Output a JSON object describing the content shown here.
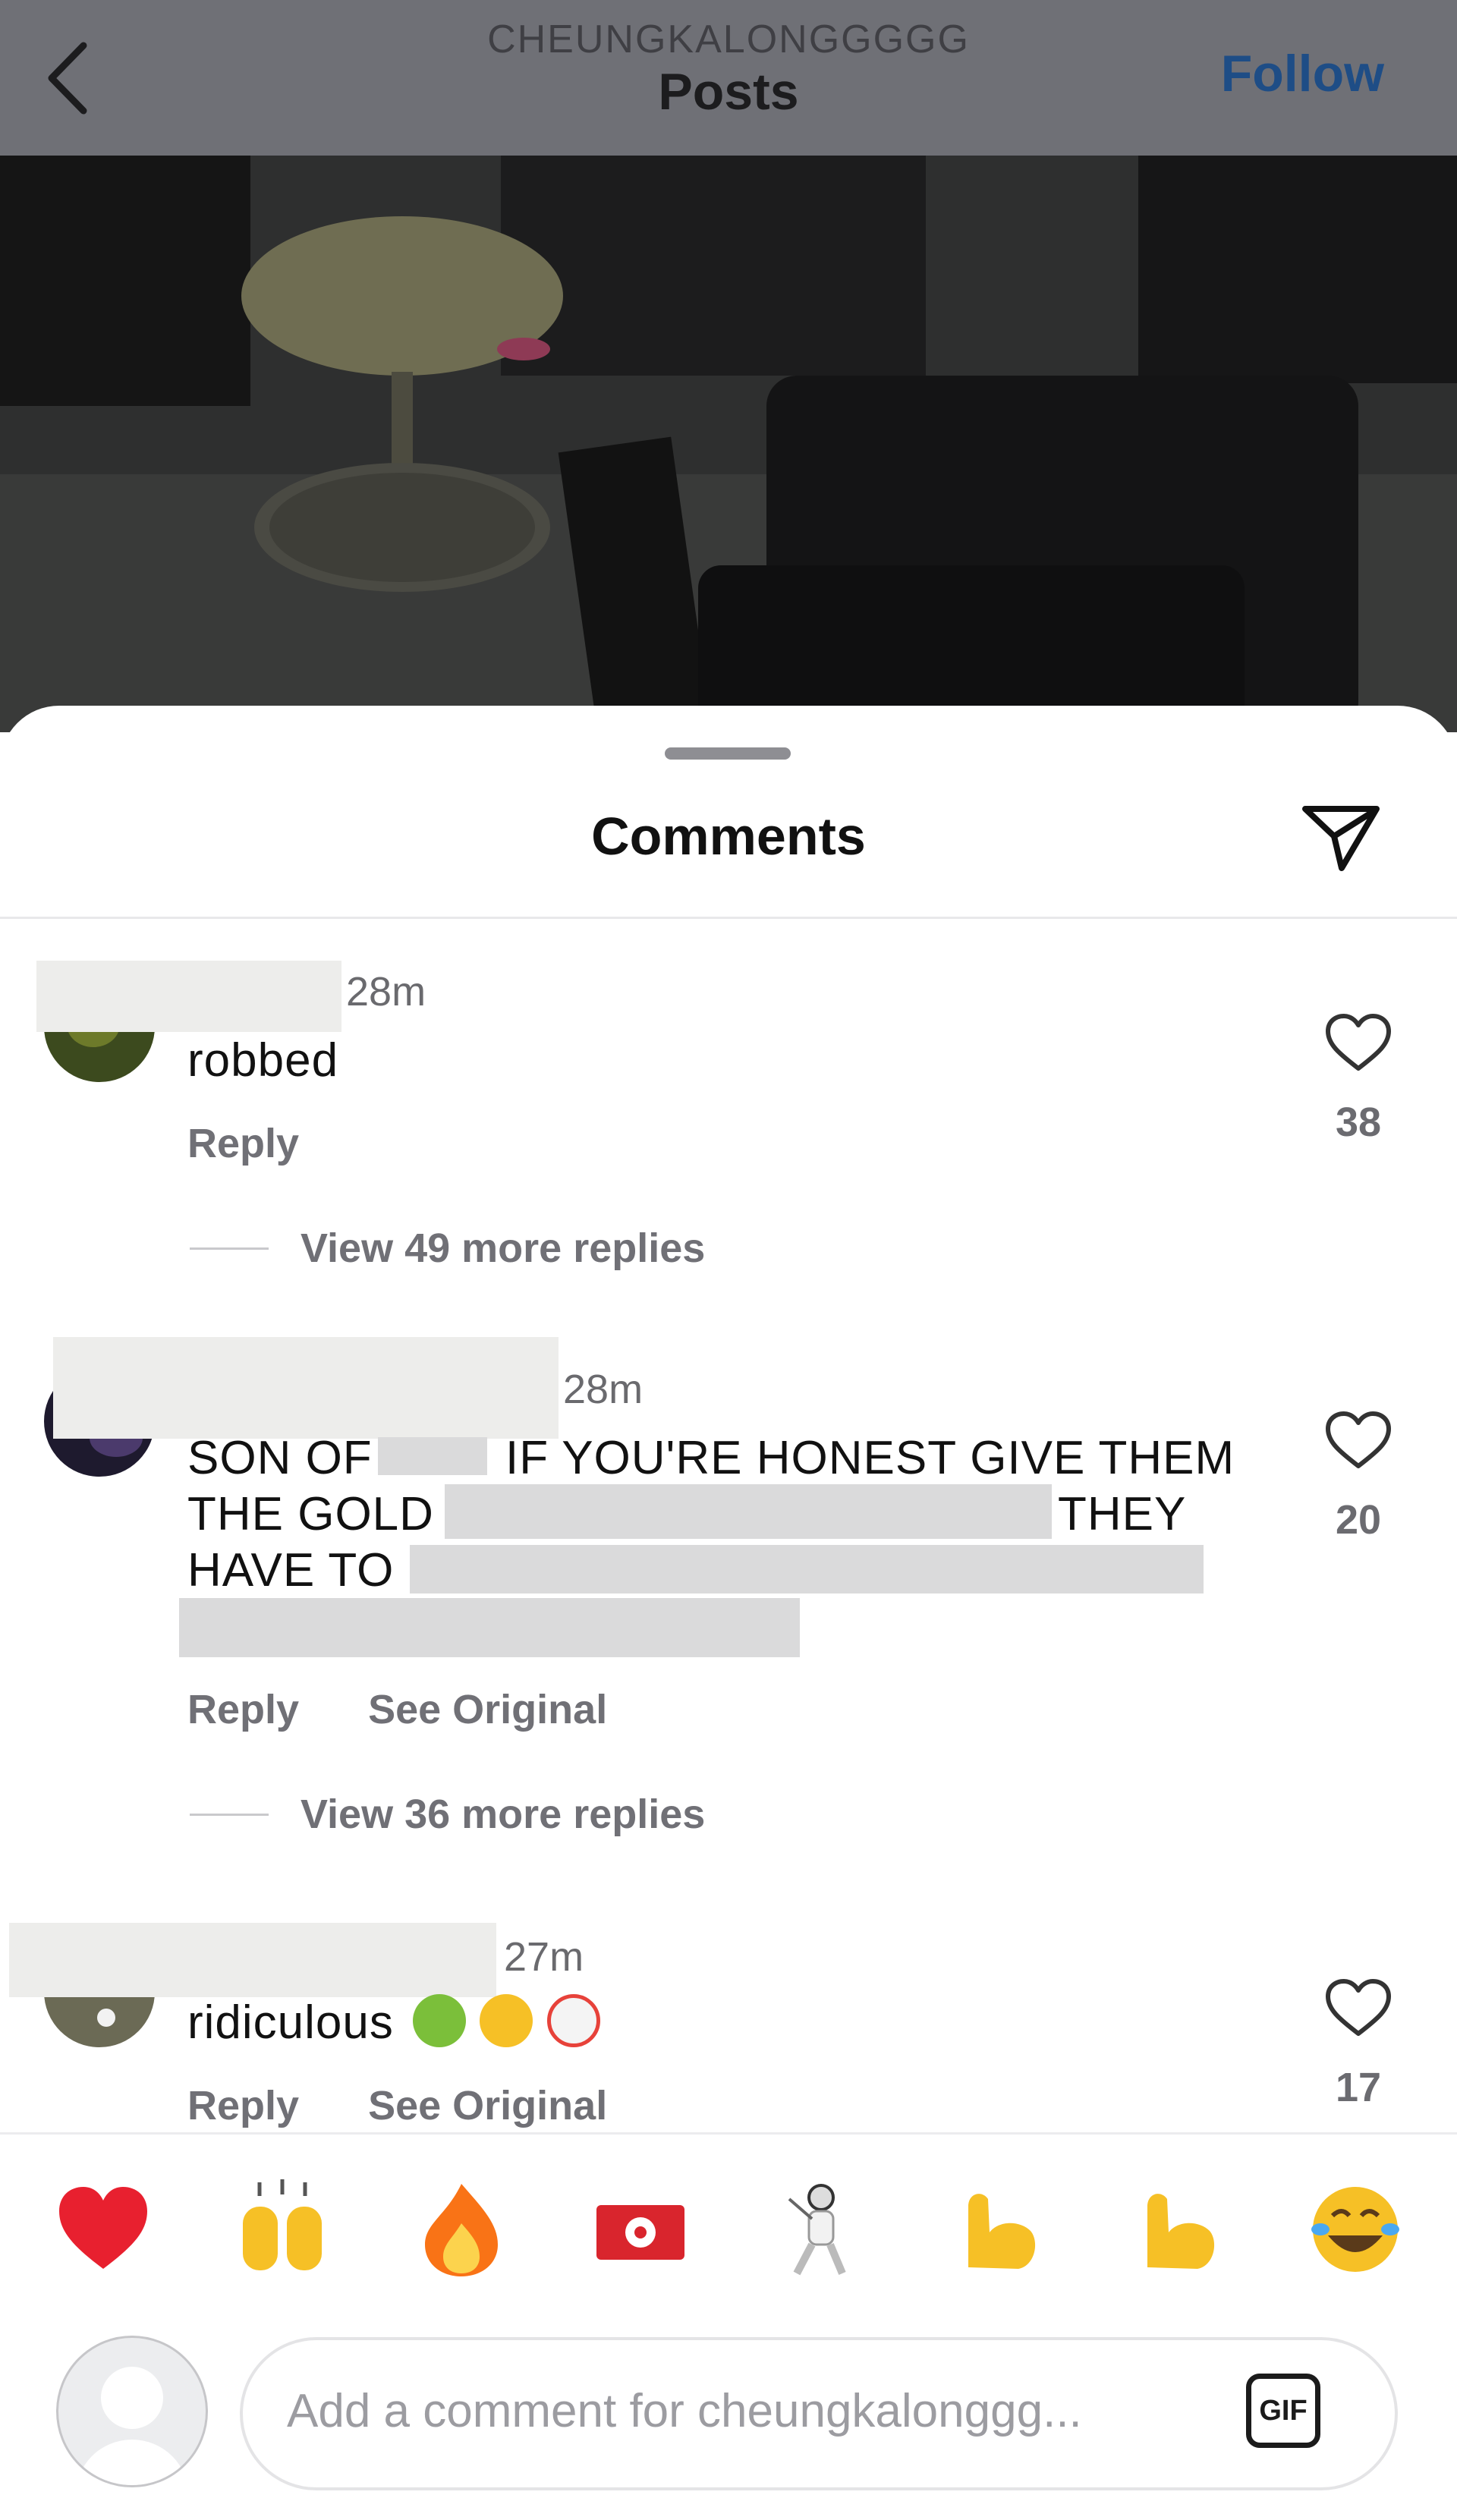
{
  "header": {
    "username": "CHEUNGKALONGGGGG",
    "title": "Posts",
    "follow_label": "Follow"
  },
  "comments_sheet": {
    "title": "Comments"
  },
  "comments": [
    {
      "time": "28m",
      "text": "robbed",
      "reply_label": "Reply",
      "likes": "38",
      "view_replies": "View 49 more replies"
    },
    {
      "time": "28m",
      "line1_a": "SON OF",
      "line1_b": "IF YOU'RE HONEST GIVE THEM",
      "line2_a": "THE GOLD",
      "line2_b": "THEY",
      "line3_a": "HAVE TO",
      "reply_label": "Reply",
      "see_original_label": "See Original",
      "likes": "20",
      "view_replies": "View 36 more replies"
    },
    {
      "time": "27m",
      "text": "ridiculous",
      "reply_label": "Reply",
      "see_original_label": "See Original",
      "likes": "17"
    }
  ],
  "quick_emojis": [
    "red-heart",
    "raising-hands",
    "fire",
    "hong-kong-flag",
    "fencer",
    "flexed-biceps",
    "flexed-biceps",
    "tears-of-joy"
  ],
  "composer": {
    "placeholder": "Add a comment for cheungkalonggg...",
    "gif_label": "GIF"
  },
  "colors": {
    "header_bg": "#6f7076",
    "follow": "#1e4d86",
    "heart_emoji": "#e8202f",
    "fire": "#f97316",
    "yellow_emoji": "#f6c026"
  }
}
